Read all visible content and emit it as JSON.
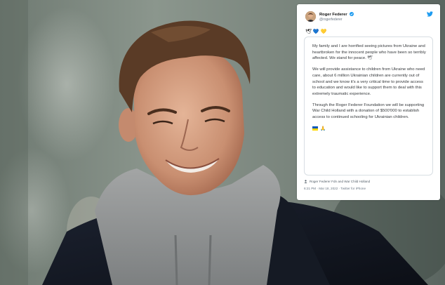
{
  "tweet": {
    "author_name": "Roger Federer",
    "handle": "@rogerfederer",
    "emoji_line": [
      "🕊",
      "💙",
      "💛"
    ],
    "paragraphs": [
      "My family and I are horrified seeing pictures from Ukraine and heartbroken for the innocent people who have been so terribly affected. We stand for peace. 🕊",
      "We will provide assistance to children from Ukraine who need care, about 6 million Ukrainian children are currently out of school and we know it's a very critical time to provide access to education and would like to support them to deal with this extremely traumatic experience.",
      "Through the Roger Federer Foundation we will be supporting War Child Holland with a donation of $500'000 to establish access to continued schooling for Ukrainian children."
    ],
    "closing_emoji": "🙏",
    "tagged": "Roger Federer Fdn and War Child Holland",
    "timestamp": "6:21 PM · Mar 18, 2022 · Twitter for iPhone",
    "colors": {
      "verified": "#1d9bf0",
      "twitter_brand": "#1d9bf0",
      "flag_blue": "#0057b7",
      "flag_yellow": "#ffd700"
    }
  }
}
